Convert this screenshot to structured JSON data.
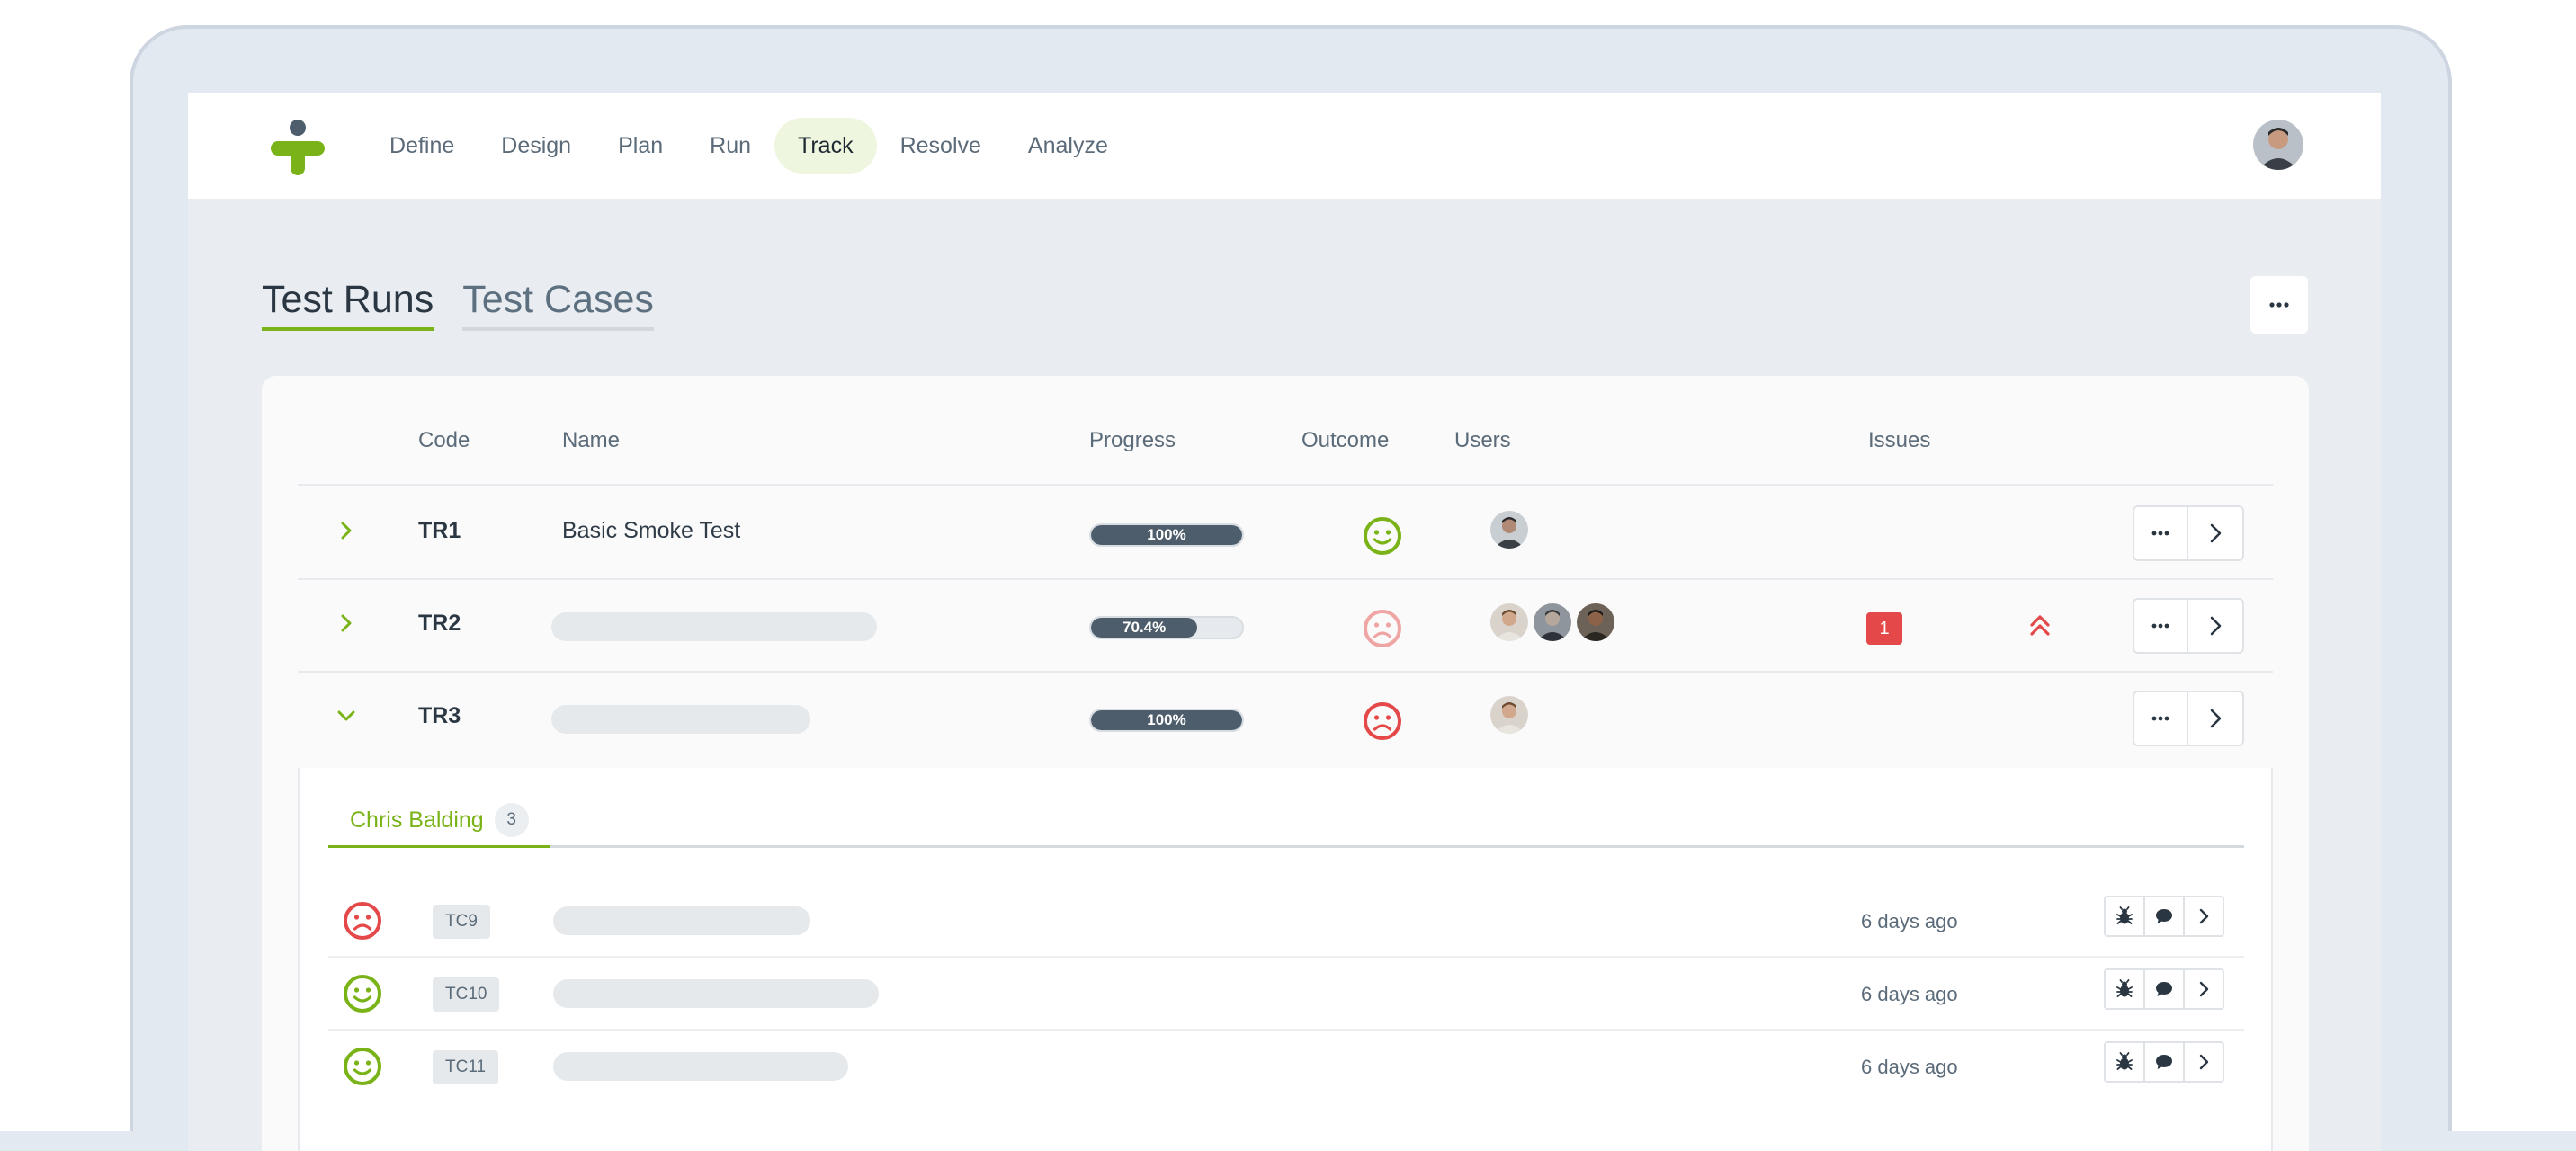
{
  "nav": {
    "items": [
      "Define",
      "Design",
      "Plan",
      "Run",
      "Track",
      "Resolve",
      "Analyze"
    ],
    "active": "Track"
  },
  "section_tabs": {
    "runs": "Test Runs",
    "cases": "Test Cases"
  },
  "table": {
    "headers": {
      "code": "Code",
      "name": "Name",
      "progress": "Progress",
      "outcome": "Outcome",
      "users": "Users",
      "issues": "Issues"
    },
    "rows": [
      {
        "code": "TR1",
        "name": "Basic Smoke Test",
        "progress_label": "100%",
        "progress": 100,
        "outcome": "happy-green",
        "users": 1,
        "issues": "",
        "expanded": false
      },
      {
        "code": "TR2",
        "name": "",
        "progress_label": "70.4%",
        "progress": 70.4,
        "outcome": "sad-faded",
        "users": 3,
        "issues": "1",
        "priority": "high",
        "expanded": false
      },
      {
        "code": "TR3",
        "name": "",
        "progress_label": "100%",
        "progress": 100,
        "outcome": "sad-red",
        "users": 1,
        "issues": "",
        "expanded": true
      }
    ]
  },
  "expanded": {
    "tab_label": "Chris Balding",
    "tab_count": "3",
    "cases": [
      {
        "code": "TC9",
        "outcome": "sad-red",
        "time": "6 days ago"
      },
      {
        "code": "TC10",
        "outcome": "happy-green",
        "time": "6 days ago"
      },
      {
        "code": "TC11",
        "outcome": "happy-green",
        "time": "6 days ago"
      }
    ]
  },
  "colors": {
    "accent": "#7ab317",
    "danger": "#e54848",
    "progress": "#4d5d6b"
  }
}
